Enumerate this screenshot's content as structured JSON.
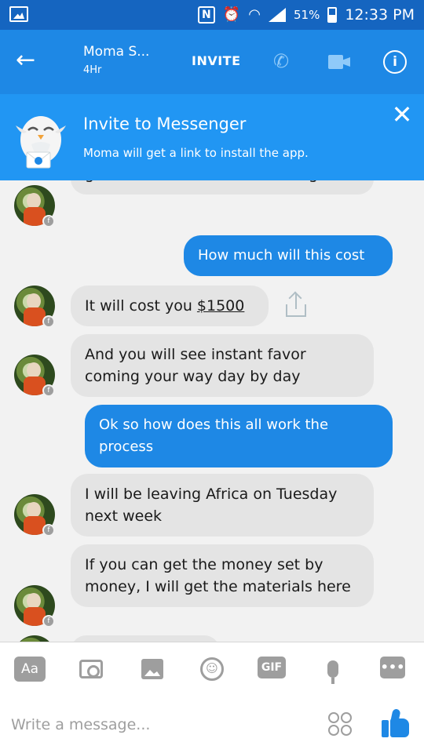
{
  "status_bar": {
    "battery_percent": "51%",
    "time": "12:33 PM",
    "icons": [
      "gallery-icon",
      "nfc-icon",
      "alarm-icon",
      "wifi-icon",
      "signal-icon",
      "battery-icon"
    ]
  },
  "header": {
    "contact_name": "Moma S...",
    "contact_status": "4Hr",
    "invite_label": "INVITE",
    "colors": {
      "bar": "#1e88e5",
      "status_bar": "#1565c0"
    }
  },
  "banner": {
    "title": "Invite to Messenger",
    "subtitle": "Moma will get a link to install the app.",
    "color": "#2196f3"
  },
  "messages": [
    {
      "from": "them",
      "text": "get the materials when coming back"
    },
    {
      "from": "me",
      "text": "How much will this cost"
    },
    {
      "from": "them",
      "text_prefix": "It will cost you ",
      "link_text": "$1500"
    },
    {
      "from": "them",
      "text": "And you will  see instant favor coming your way day by day"
    },
    {
      "from": "me",
      "text": "Ok so how does this all work the process"
    },
    {
      "from": "them",
      "text": "I will be leaving Africa on Tuesday next week"
    },
    {
      "from": "them",
      "text": "If you can get the money set by money, I will get the materials here"
    }
  ],
  "avatar_badge": "f",
  "composer": {
    "aa_label": "Aa",
    "gif_label": "GIF",
    "more_label": "•••",
    "smile_glyph": "☺",
    "placeholder": "Write a message..."
  }
}
